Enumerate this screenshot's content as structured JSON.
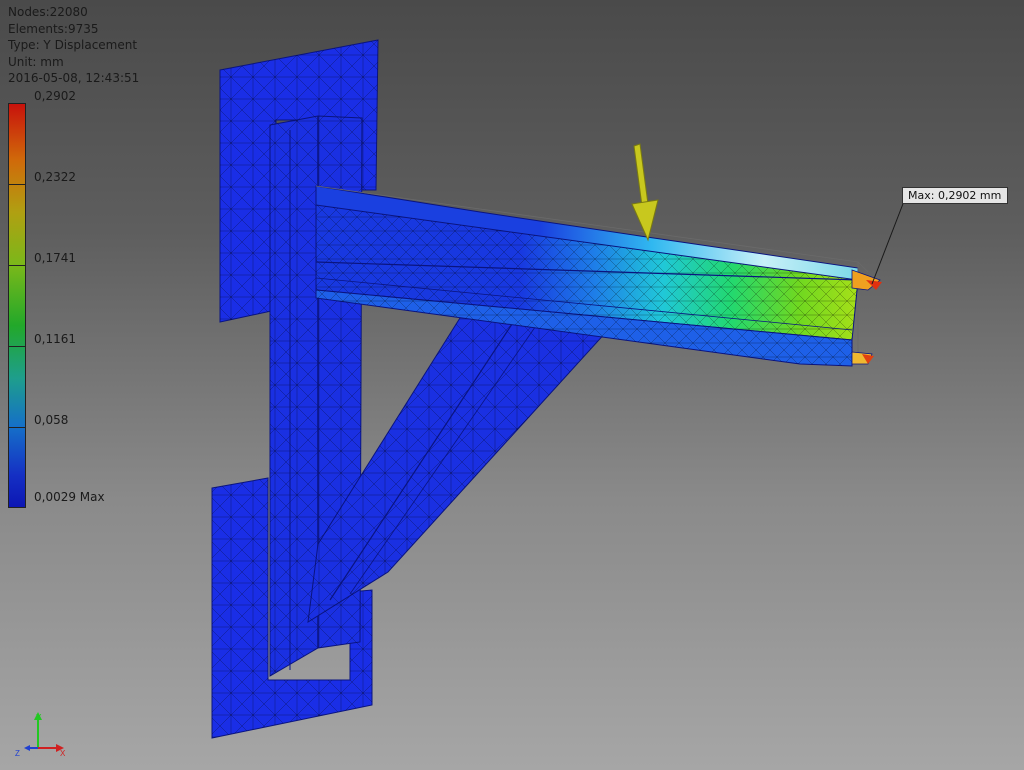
{
  "info": {
    "nodes": "Nodes:22080",
    "elements": "Elements:9735",
    "type": "Type: Y Displacement",
    "unit": "Unit: mm",
    "timestamp": "2016-05-08, 12:43:51"
  },
  "legend": {
    "labels": [
      "0,2902",
      "0,2322",
      "0,1741",
      "0,1161",
      "0,058",
      "0,0029 Max"
    ],
    "colors": {
      "max": "#c8120c",
      "min": "#0c16b4"
    }
  },
  "max_annotation": "Max: 0,2902 mm",
  "axes": {
    "x": "X",
    "y": "Y",
    "z": "Z"
  },
  "load_arrow_color": "#c8c81e"
}
